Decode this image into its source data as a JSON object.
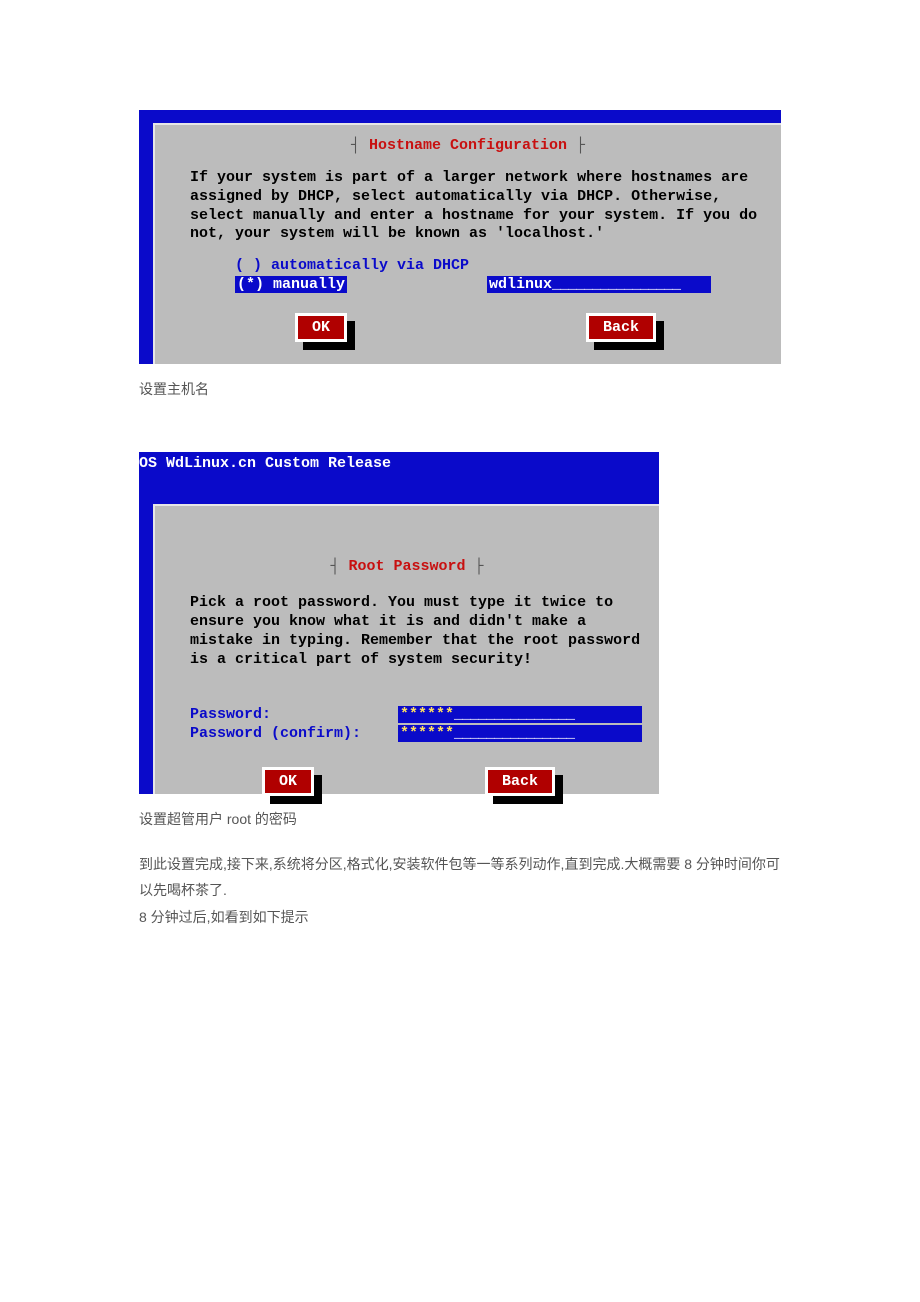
{
  "hostname_dialog": {
    "title": "Hostname Configuration",
    "description": "If your system is part of a larger network where hostnames are assigned by DHCP, select automatically via DHCP. Otherwise, select manually and enter a hostname for your system. If you do not, your system will be known as 'localhost.'",
    "radio_dhcp": "( ) automatically via DHCP",
    "radio_manual": "(*) manually",
    "hostname_value": "wdlinux",
    "ok_label": "OK",
    "back_label": "Back"
  },
  "caption1": "设置主机名",
  "rootpw_dialog": {
    "header": "OS WdLinux.cn Custom Release",
    "title": "Root Password",
    "description": "Pick a root password. You must type it twice to ensure you know what it is and didn't make a mistake in typing. Remember that the root password is a critical part of system security!",
    "pw_label": "Password:",
    "pwc_label": "Password (confirm):",
    "pw_value": "******",
    "pwc_value": "******",
    "ok_label": "OK",
    "back_label": "Back"
  },
  "caption2": "设置超管用户 root 的密码",
  "body1": "到此设置完成,接下来,系统将分区,格式化,安装软件包等一等系列动作,直到完成.大概需要 8 分钟时间你可以先喝杯茶了.",
  "body2": "8 分钟过后,如看到如下提示"
}
